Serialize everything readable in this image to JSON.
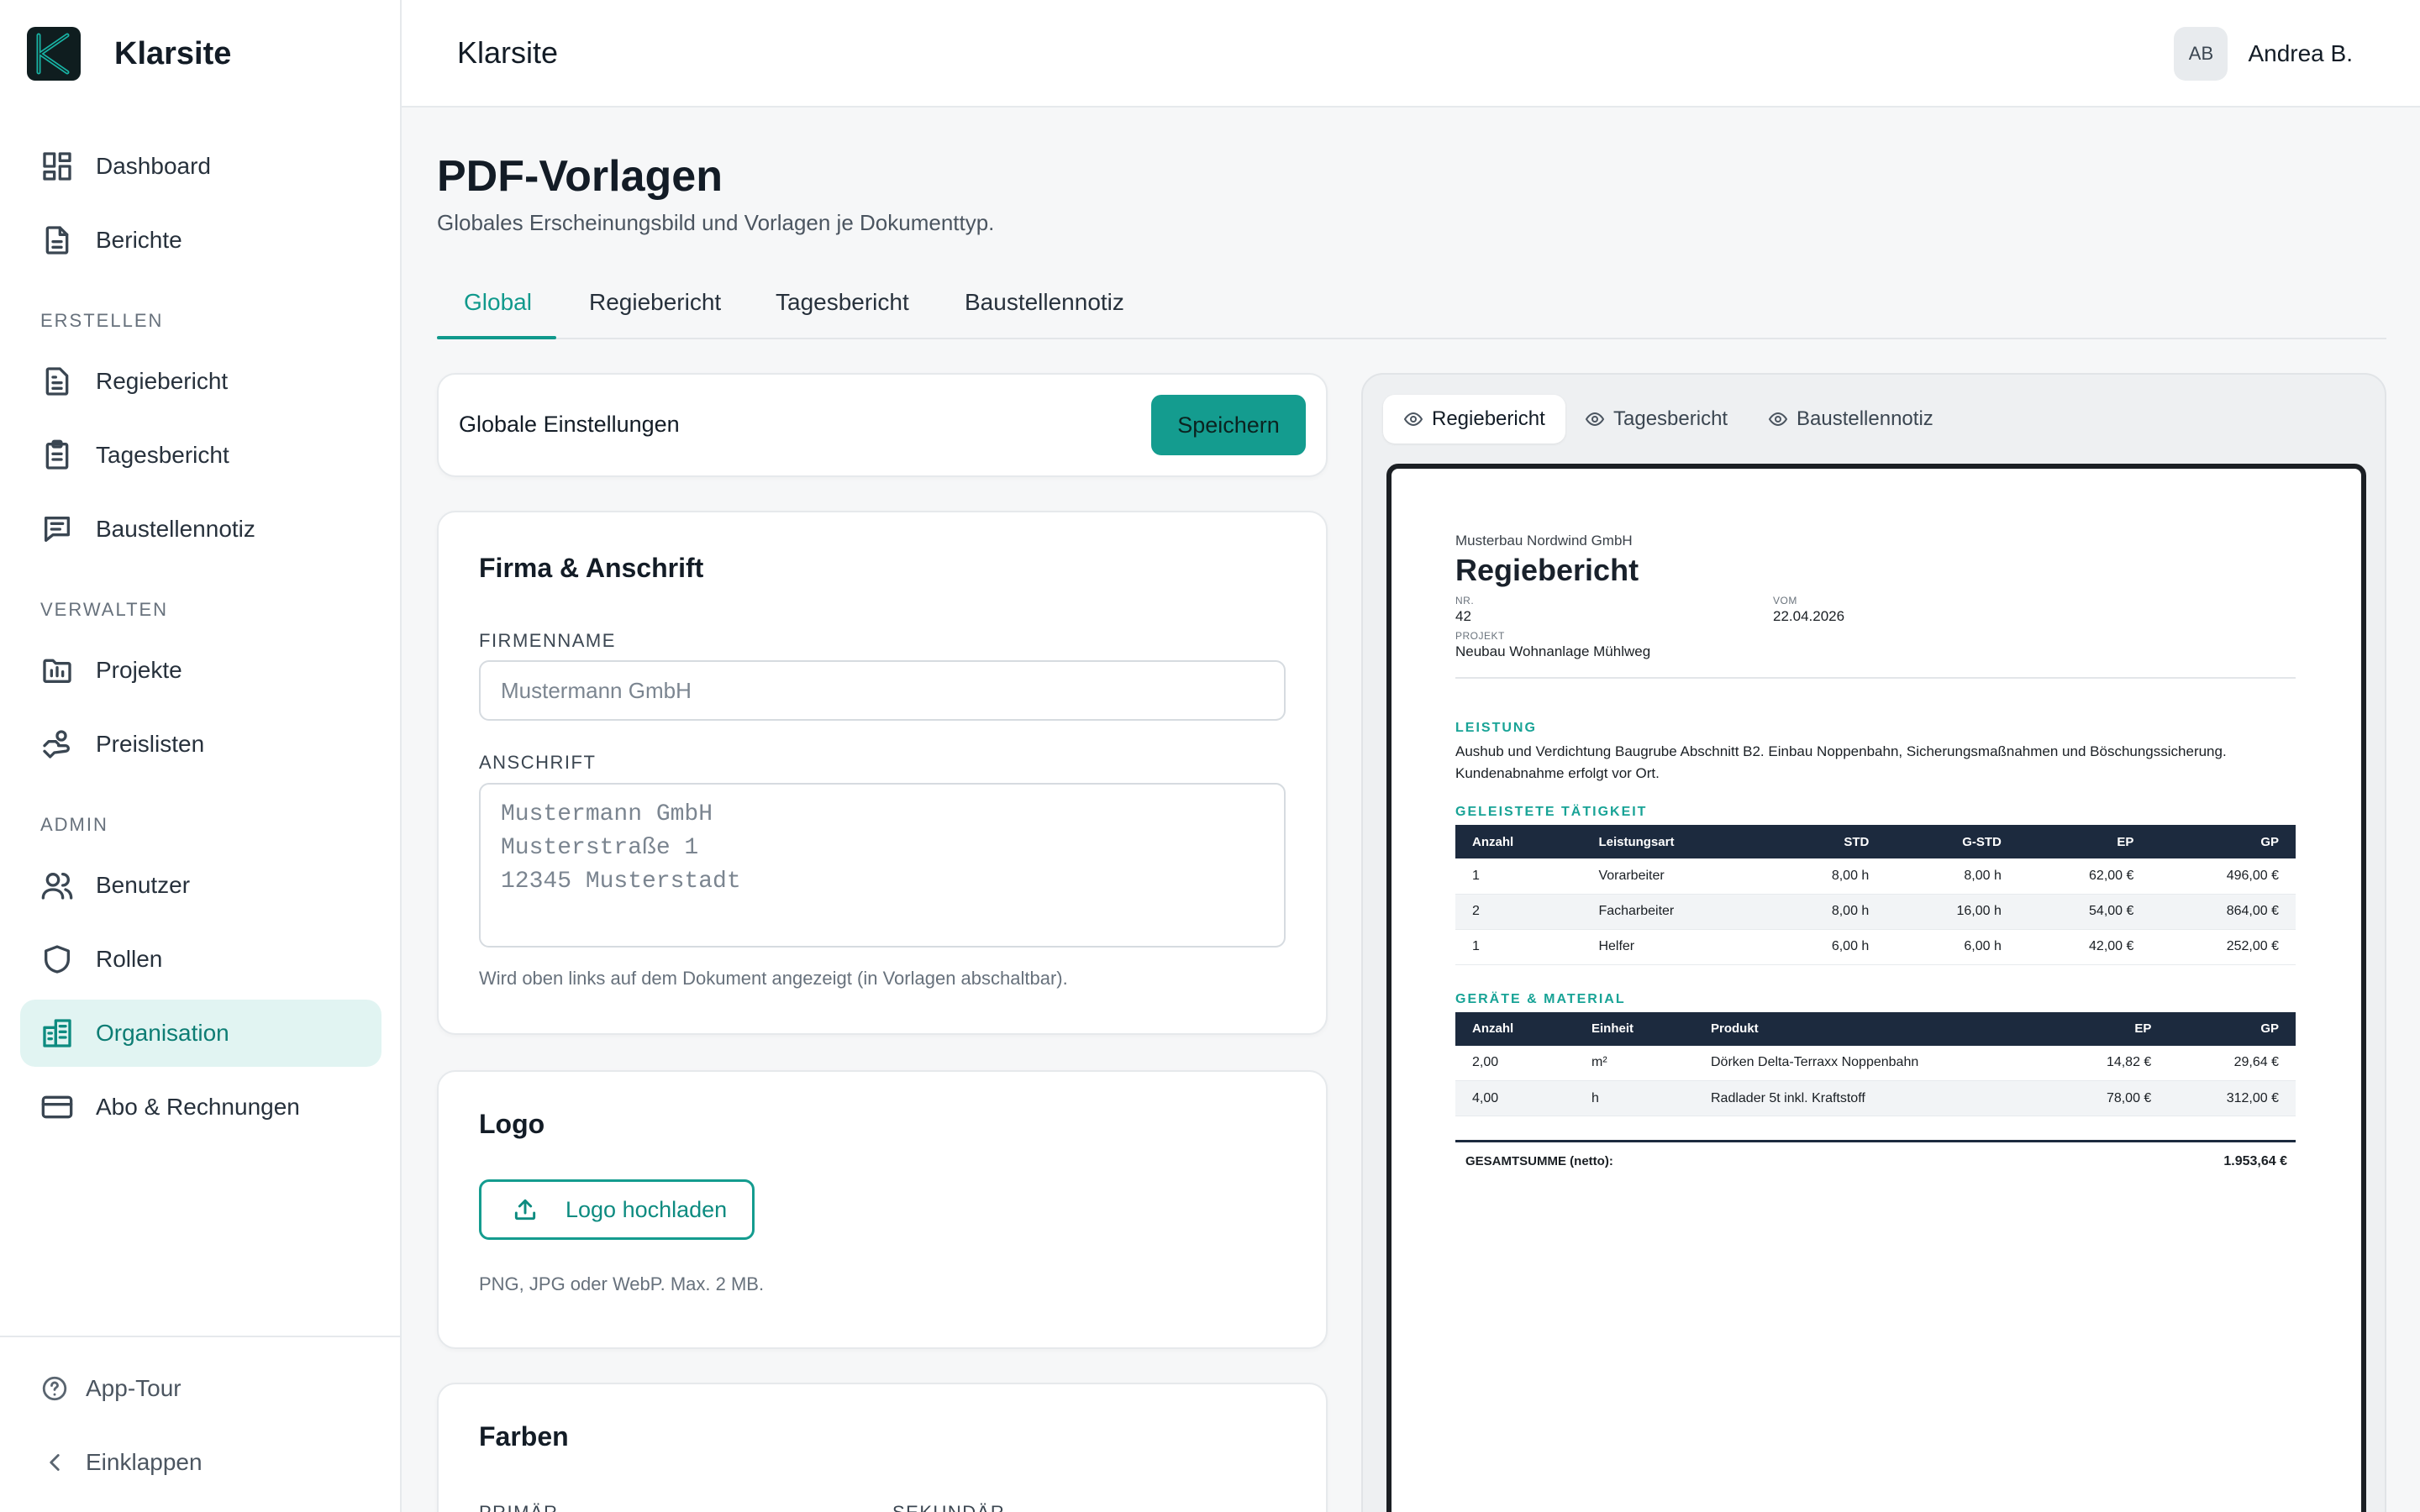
{
  "app": {
    "name": "Klarsite",
    "logo_letter": "K"
  },
  "sidebar": {
    "items_top": [
      {
        "label": "Dashboard",
        "icon": "dashboard-icon"
      },
      {
        "label": "Berichte",
        "icon": "document-icon"
      }
    ],
    "sections": [
      {
        "title": "ERSTELLEN",
        "items": [
          {
            "label": "Regiebericht",
            "icon": "report-icon"
          },
          {
            "label": "Tagesbericht",
            "icon": "clipboard-icon"
          },
          {
            "label": "Baustellennotiz",
            "icon": "note-icon"
          }
        ]
      },
      {
        "title": "VERWALTEN",
        "items": [
          {
            "label": "Projekte",
            "icon": "folder-icon"
          },
          {
            "label": "Preislisten",
            "icon": "price-icon"
          }
        ]
      },
      {
        "title": "ADMIN",
        "items": [
          {
            "label": "Benutzer",
            "icon": "users-icon"
          },
          {
            "label": "Rollen",
            "icon": "shield-icon"
          },
          {
            "label": "Organisation",
            "icon": "building-icon",
            "active": true
          },
          {
            "label": "Abo & Rechnungen",
            "icon": "credit-card-icon"
          }
        ]
      }
    ],
    "footer": [
      {
        "label": "App-Tour",
        "icon": "help-icon"
      },
      {
        "label": "Einklappen",
        "icon": "chevron-left-icon"
      }
    ]
  },
  "topbar": {
    "title": "Klarsite",
    "user": {
      "initials": "AB",
      "name": "Andrea B."
    }
  },
  "page": {
    "title": "PDF-Vorlagen",
    "subtitle": "Globales Erscheinungsbild und Vorlagen je Dokumenttyp.",
    "tabs": [
      "Global",
      "Regiebericht",
      "Tagesbericht",
      "Baustellennotiz"
    ],
    "active_tab": "Global"
  },
  "settings": {
    "title": "Globale Einstellungen",
    "save_label": "Speichern"
  },
  "company": {
    "title": "Firma & Anschrift",
    "name_label": "FIRMENNAME",
    "name_placeholder": "Mustermann GmbH",
    "address_label": "ANSCHRIFT",
    "address_placeholder": "Mustermann GmbH\nMusterstraße 1\n12345 Musterstadt",
    "address_hint": "Wird oben links auf dem Dokument angezeigt (in Vorlagen abschaltbar)."
  },
  "logo": {
    "title": "Logo",
    "upload_label": "Logo hochladen",
    "hint": "PNG, JPG oder WebP. Max. 2 MB."
  },
  "colors": {
    "title": "Farben",
    "primary_label": "PRIMÄR",
    "secondary_label": "SEKUNDÄR"
  },
  "preview": {
    "tabs": [
      "Regiebericht",
      "Tagesbericht",
      "Baustellennotiz"
    ],
    "active_tab": "Regiebericht",
    "doc": {
      "company": "Musterbau Nordwind GmbH",
      "title": "Regiebericht",
      "nr_label": "NR.",
      "nr": "42",
      "date_label": "VOM",
      "date": "22.04.2026",
      "project_label": "PROJEKT",
      "project": "Neubau Wohnanlage Mühlweg",
      "leistung_title": "LEISTUNG",
      "leistung_text": "Aushub und Verdichtung Baugrube Abschnitt B2. Einbau Noppenbahn, Sicherungsmaßnahmen und Böschungssicherung. Kundenabnahme erfolgt vor Ort.",
      "work_title": "GELEISTETE TÄTIGKEIT",
      "work_headers": [
        "Anzahl",
        "Leistungsart",
        "STD",
        "G-STD",
        "EP",
        "GP"
      ],
      "work_rows": [
        [
          "1",
          "Vorarbeiter",
          "8,00 h",
          "8,00 h",
          "62,00 €",
          "496,00 €"
        ],
        [
          "2",
          "Facharbeiter",
          "8,00 h",
          "16,00 h",
          "54,00 €",
          "864,00 €"
        ],
        [
          "1",
          "Helfer",
          "6,00 h",
          "6,00 h",
          "42,00 €",
          "252,00 €"
        ]
      ],
      "material_title": "GERÄTE & MATERIAL",
      "material_headers": [
        "Anzahl",
        "Einheit",
        "Produkt",
        "EP",
        "GP"
      ],
      "material_rows": [
        [
          "2,00",
          "m²",
          "Dörken Delta-Terraxx Noppenbahn",
          "14,82 €",
          "29,64 €"
        ],
        [
          "4,00",
          "h",
          "Radlader 5t inkl. Kraftstoff",
          "78,00 €",
          "312,00 €"
        ]
      ],
      "total_label": "GESAMTSUMME (netto):",
      "total": "1.953,64 €"
    }
  },
  "colors_theme": {
    "accent": "#149c8f",
    "active_bg": "#e1f4f2",
    "table_header": "#1c2a3e"
  }
}
